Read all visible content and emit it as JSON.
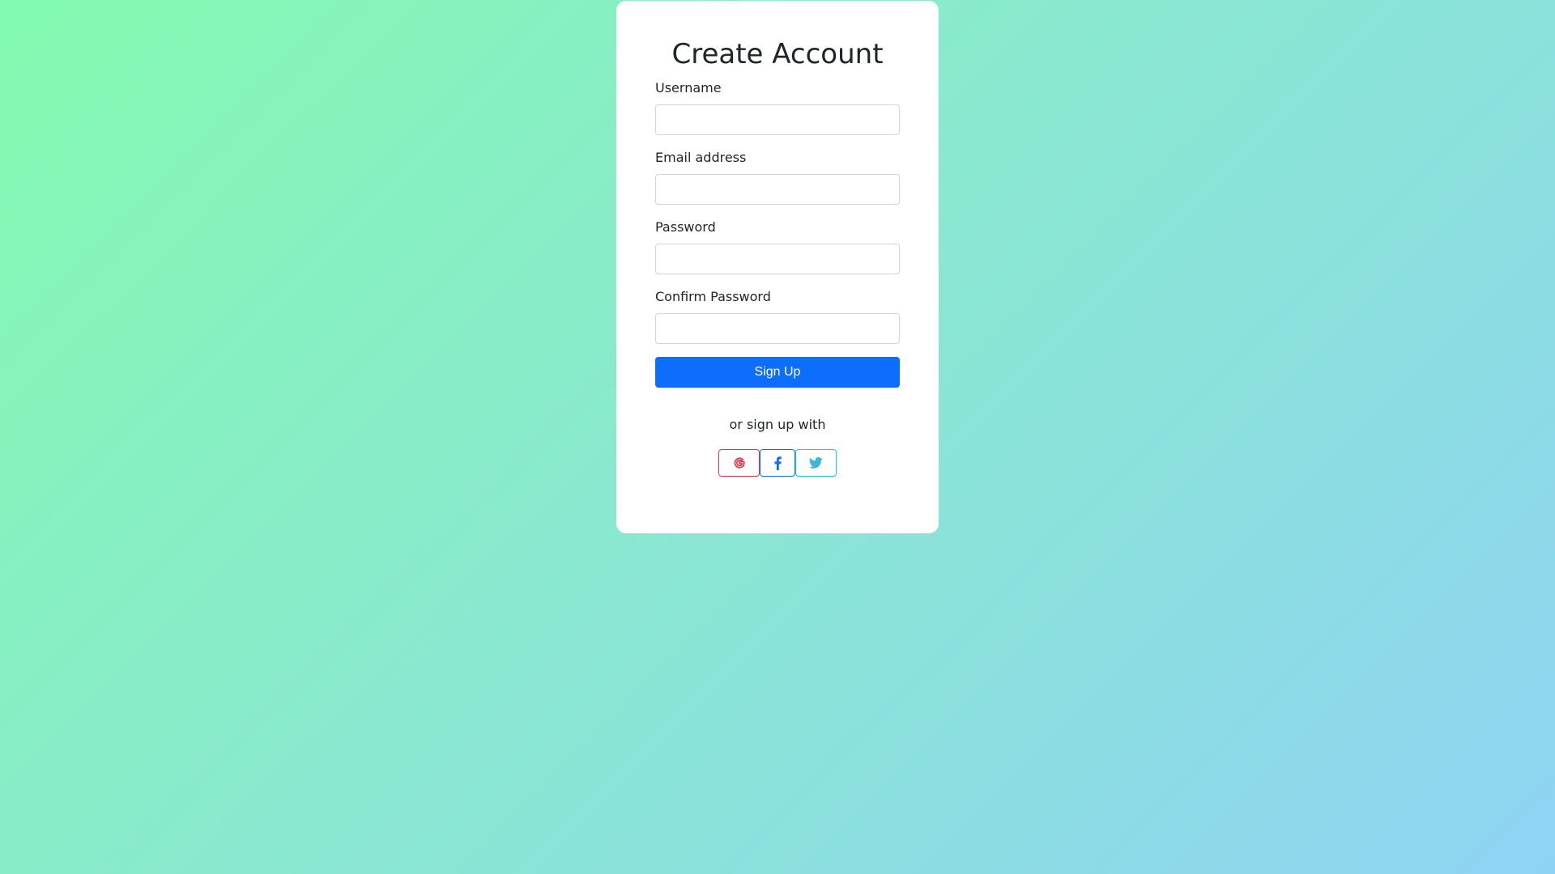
{
  "form": {
    "title": "Create Account",
    "fields": [
      {
        "label": "Username",
        "value": "",
        "placeholder": ""
      },
      {
        "label": "Email address",
        "value": "",
        "placeholder": ""
      },
      {
        "label": "Password",
        "value": "",
        "placeholder": ""
      },
      {
        "label": "Confirm Password",
        "value": "",
        "placeholder": ""
      }
    ],
    "submit_label": "Sign Up",
    "social_prompt": "or sign up with",
    "social": [
      {
        "icon": "google-icon",
        "color": "#dc3545"
      },
      {
        "icon": "facebook-icon",
        "color": "#0d6efd"
      },
      {
        "icon": "twitter-icon",
        "color": "#0dcaf0"
      }
    ]
  },
  "colors": {
    "background_start": "#84fab0",
    "background_end": "#8fd3f4",
    "primary": "#0d6efd"
  }
}
